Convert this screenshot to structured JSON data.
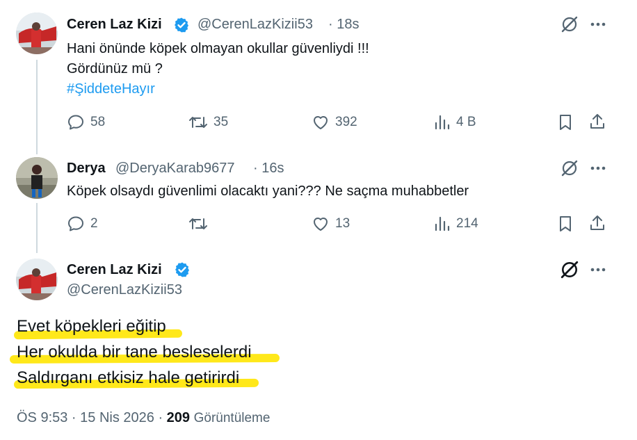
{
  "tweet1": {
    "name": "Ceren Laz Kizi",
    "handle": "@CerenLazKizii53",
    "time": "· 18s",
    "line1": "Hani önünde köpek olmayan okullar güvenliydi !!!",
    "line2": "Gördünüz mü ?",
    "hashtag": "#ŞiddeteHayır",
    "replies": "58",
    "retweets": "35",
    "likes": "392",
    "views": "4 B"
  },
  "tweet2": {
    "name": "Derya",
    "handle": "@DeryaKarab9677",
    "time": "· 16s",
    "text": "Köpek olsaydı güvenlimi olacaktı yani??? Ne saçma muhabbetler",
    "replies": "2",
    "retweets": "",
    "likes": "13",
    "views": "214"
  },
  "tweet3": {
    "name": "Ceren Laz Kizi",
    "handle": "@CerenLazKizii53",
    "line1": "Evet köpekleri eğitip",
    "line2": "Her okulda bir tane besleselerdi",
    "line3": "Saldırganı etkisiz hale getirirdi",
    "timestamp": "ÖS 9:53 · 15 Nis 2026 ·",
    "view_count": "209",
    "view_label": "Görüntüleme"
  },
  "colors": {
    "accent": "#1d9bf0",
    "muted": "#536471",
    "highlight": "#ffe81a"
  },
  "icons": [
    "verified-badge-icon",
    "grok-icon",
    "more-icon",
    "reply-icon",
    "retweet-icon",
    "like-icon",
    "views-icon",
    "bookmark-icon",
    "share-icon"
  ]
}
